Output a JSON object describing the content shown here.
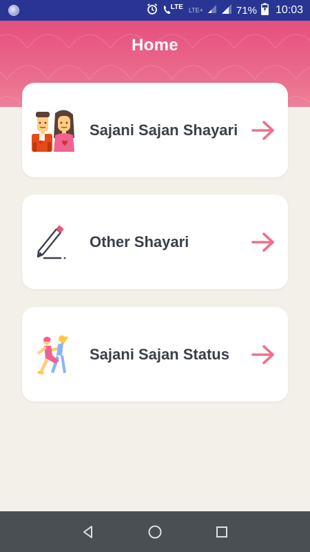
{
  "status_bar": {
    "network_label": "LTE",
    "secondary_network_label": "LTE+",
    "battery": "71%",
    "time": "10:03"
  },
  "header": {
    "title": "Home"
  },
  "cards": [
    {
      "label": "Sajani Sajan Shayari",
      "icon": "couple-icon"
    },
    {
      "label": "Other Shayari",
      "icon": "pencil-writing-icon"
    },
    {
      "label": "Sajani Sajan Status",
      "icon": "dancing-couple-icon"
    }
  ],
  "colors": {
    "status_bar": "#283593",
    "header_gradient_start": "#e5507f",
    "header_gradient_end": "#ef8099",
    "arrow": "#f06f8c",
    "background": "#f3f0ea",
    "card_text": "#3a3f4b",
    "nav_bar": "#4a4f54"
  },
  "nav_bar": {
    "buttons": [
      "back-icon",
      "home-icon",
      "recents-icon"
    ]
  }
}
